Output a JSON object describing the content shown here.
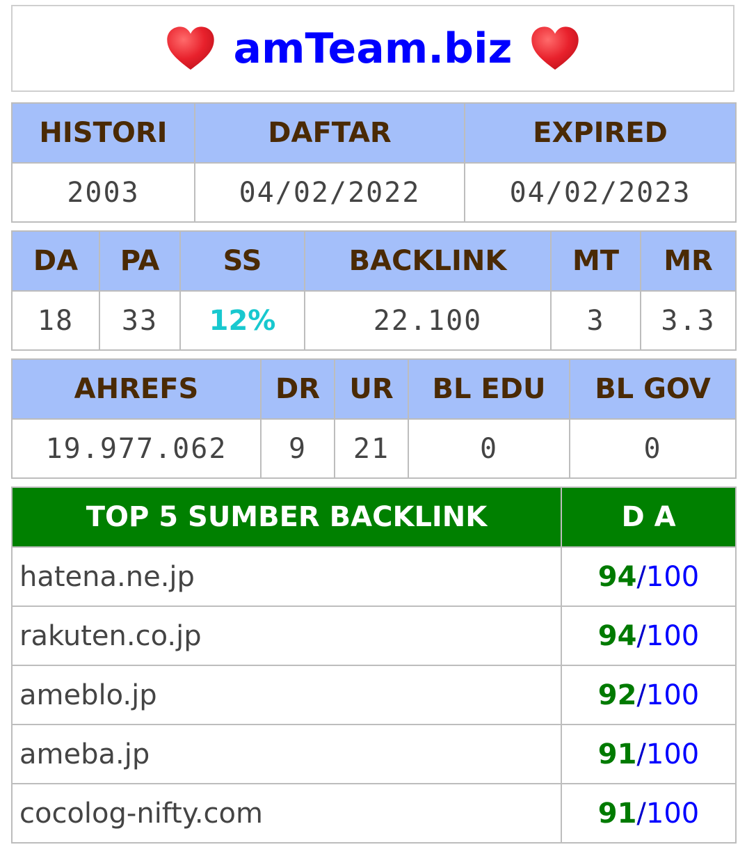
{
  "title": {
    "text": "amTeam.biz",
    "left_icon": "heart-icon",
    "right_icon": "heart-icon",
    "color": "#0000ff",
    "heart_color": "#e8212c"
  },
  "table1": {
    "headers": [
      "HISTORI",
      "DAFTAR",
      "EXPIRED"
    ],
    "values": [
      "2003",
      "04/02/2022",
      "04/02/2023"
    ]
  },
  "table2": {
    "headers": [
      "DA",
      "PA",
      "SS",
      "BACKLINK",
      "MT",
      "MR"
    ],
    "values": [
      "18",
      "33",
      "12%",
      "22.100",
      "3",
      "3.3"
    ]
  },
  "table3": {
    "headers": [
      "AHREFS",
      "DR",
      "UR",
      "BL EDU",
      "BL GOV"
    ],
    "values": [
      "19.977.062",
      "9",
      "21",
      "0",
      "0"
    ]
  },
  "table4": {
    "headers": [
      "TOP 5 SUMBER BACKLINK",
      "D A"
    ],
    "rows": [
      {
        "source": "hatena.ne.jp",
        "score": "94",
        "sep": "/",
        "max": "100"
      },
      {
        "source": "rakuten.co.jp",
        "score": "94",
        "sep": "/",
        "max": "100"
      },
      {
        "source": "ameblo.jp",
        "score": "92",
        "sep": "/",
        "max": "100"
      },
      {
        "source": "ameba.jp",
        "score": "91",
        "sep": "/",
        "max": "100"
      },
      {
        "source": "cocolog-nifty.com",
        "score": "91",
        "sep": "/",
        "max": "100"
      }
    ]
  },
  "colors": {
    "header_bg": "#a4bffa",
    "header_text": "#4a2a05",
    "top5_header_bg": "#008000",
    "ss_value": "#18c8cf",
    "da_score": "#007a00",
    "da_max": "#0000ff"
  }
}
